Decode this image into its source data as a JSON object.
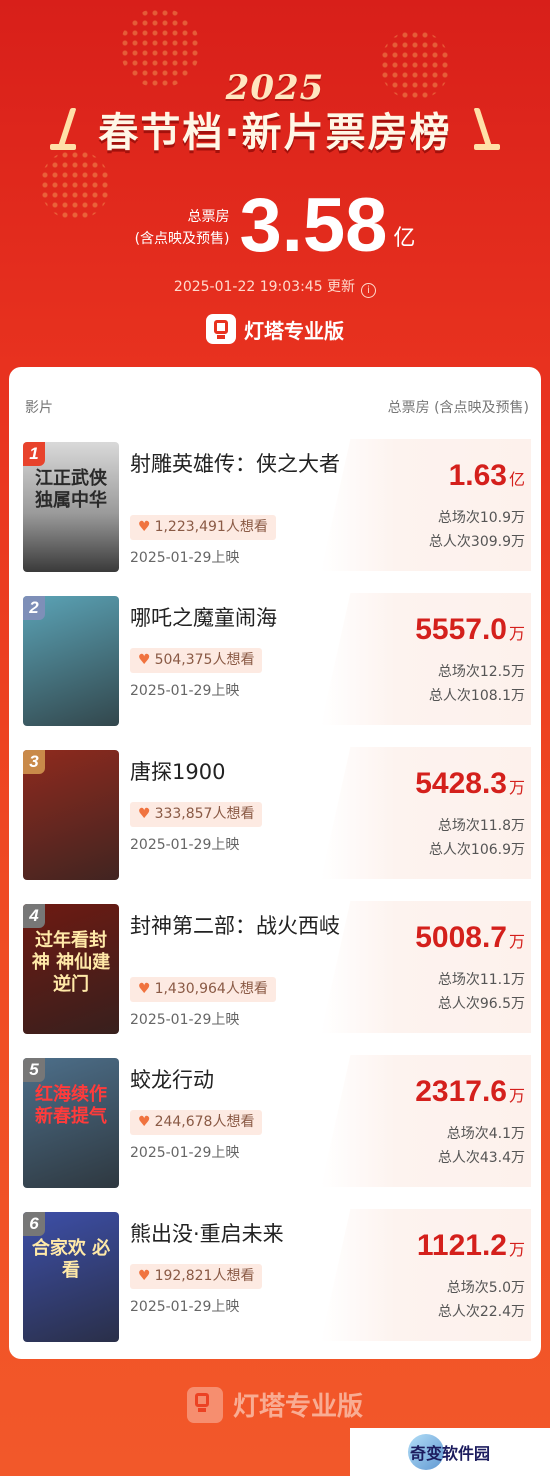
{
  "header": {
    "year": "2025",
    "title": "春节档·新片票房榜",
    "total_label_line1": "总票房",
    "total_label_line2": "(含点映及预售)",
    "total_value": "3.58",
    "total_unit": "亿",
    "update_text": "2025-01-22 19:03:45 更新",
    "info_icon": "ⓘ",
    "brand": "灯塔专业版"
  },
  "table": {
    "col_movie": "影片",
    "col_box": "总票房 (含点映及预售)"
  },
  "movies": [
    {
      "rank": "1",
      "name": "射雕英雄传：侠之大者",
      "want": "1,223,491人想看",
      "release": "2025-01-29上映",
      "box_value": "1.63",
      "box_unit": "亿",
      "screenings": "总场次10.9万",
      "admissions": "总人次309.9万",
      "poster_text": "江正武侠 独属中华",
      "poster_color": "#8c8c8c",
      "rank_color": "#e8432c"
    },
    {
      "rank": "2",
      "name": "哪吒之魔童闹海",
      "want": "504,375人想看",
      "release": "2025-01-29上映",
      "box_value": "5557.0",
      "box_unit": "万",
      "screenings": "总场次12.5万",
      "admissions": "总人次108.1万",
      "poster_text": "",
      "poster_color": "#5ba3b6",
      "rank_color": "#7e8fb8"
    },
    {
      "rank": "3",
      "name": "唐探1900",
      "want": "333,857人想看",
      "release": "2025-01-29上映",
      "box_value": "5428.3",
      "box_unit": "万",
      "screenings": "总场次11.8万",
      "admissions": "总人次106.9万",
      "poster_text": "",
      "poster_color": "#8f2a1e",
      "rank_color": "#c98a4a"
    },
    {
      "rank": "4",
      "name": "封神第二部：战火西岐",
      "want": "1,430,964人想看",
      "release": "2025-01-29上映",
      "box_value": "5008.7",
      "box_unit": "万",
      "screenings": "总场次11.1万",
      "admissions": "总人次96.5万",
      "poster_text": "过年看封神 神仙建逆门",
      "poster_color": "#6e1a12",
      "rank_color": "#777777"
    },
    {
      "rank": "5",
      "name": "蛟龙行动",
      "want": "244,678人想看",
      "release": "2025-01-29上映",
      "box_value": "2317.6",
      "box_unit": "万",
      "screenings": "总场次4.1万",
      "admissions": "总人次43.4万",
      "poster_text": "红海续作 新春提气",
      "poster_color": "#4d6f8a",
      "rank_color": "#777777"
    },
    {
      "rank": "6",
      "name": "熊出没·重启未来",
      "want": "192,821人想看",
      "release": "2025-01-29上映",
      "box_value": "1121.2",
      "box_unit": "万",
      "screenings": "总场次5.0万",
      "admissions": "总人次22.4万",
      "poster_text": "合家欢 必看",
      "poster_color": "#3d4fa8",
      "rank_color": "#777777"
    }
  ],
  "footer": {
    "brand": "灯塔专业版",
    "watermark": "奇变软件园"
  }
}
